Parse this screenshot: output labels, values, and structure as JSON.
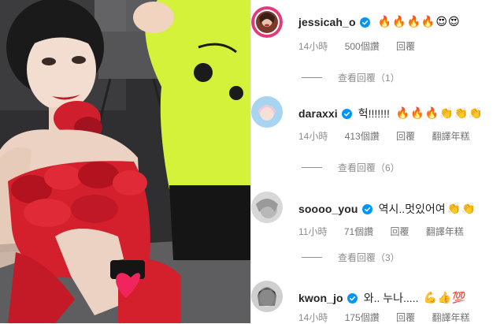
{
  "comments": [
    {
      "username": "jessicah_o",
      "text": "",
      "emojis": [
        "🔥",
        "🔥",
        "🔥",
        "🔥",
        "😍",
        "😍"
      ],
      "time": "14小時",
      "likes": "500個讚",
      "reply_label": "回覆",
      "translate_label": "",
      "view_replies": "查看回覆（1）"
    },
    {
      "username": "daraxxi",
      "text": "헉!!!!!!!",
      "emojis": [
        "🔥",
        "🔥",
        "🔥",
        "👏",
        "👏",
        "👏"
      ],
      "time": "14小時",
      "likes": "413個讚",
      "reply_label": "回覆",
      "translate_label": "翻譯年糕",
      "view_replies": "查看回覆（6）"
    },
    {
      "username": "soooo_you",
      "text": "역시..멋있어여",
      "emojis": [
        "👏",
        "👏"
      ],
      "time": "11小時",
      "likes": "71個讚",
      "reply_label": "回覆",
      "translate_label": "翻譯年糕",
      "view_replies": "查看回覆（3）"
    },
    {
      "username": "kwon_jo",
      "text": "와.. 누나.....",
      "emojis": [
        "💪",
        "👍",
        "💯"
      ],
      "time": "14小時",
      "likes": "175個讚",
      "reply_label": "回覆",
      "translate_label": "翻譯年糕",
      "view_replies": ""
    }
  ],
  "colors": {
    "verified_blue": "#0095f6",
    "meta_gray": "#8e8e8e",
    "text_dark": "#262626",
    "dress_red": "#d41f2d",
    "neon_yellow": "#d4f23a"
  },
  "icons": {
    "verified": "verified-badge-icon"
  }
}
